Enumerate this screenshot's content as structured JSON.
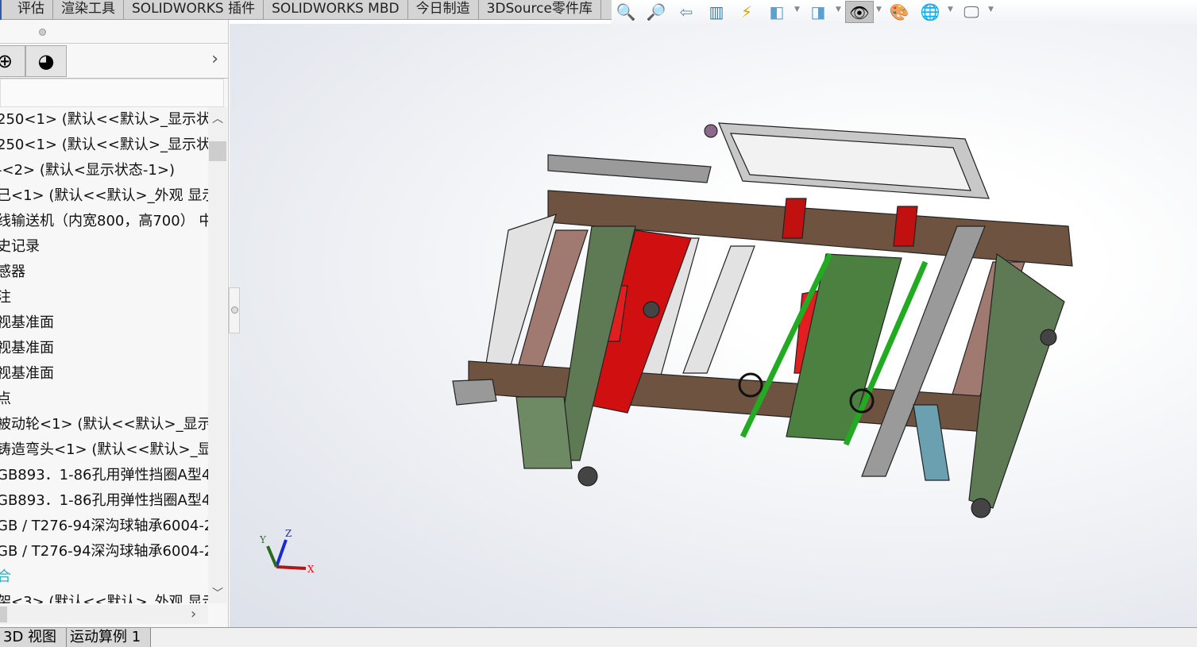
{
  "ribbon_tabs": [
    "评估",
    "渲染工具",
    "SOLIDWORKS 插件",
    "SOLIDWORKS MBD",
    "今日制造",
    "3DSource零件库"
  ],
  "view_toolbar": {
    "icons": [
      "zoom-to-fit-icon",
      "zoom-to-area-icon",
      "previous-view-icon",
      "section-view-icon",
      "dynamic-annotation-view-icon",
      "view-orientation-icon",
      "display-style-icon",
      "hide-show-items-icon",
      "edit-appearance-icon",
      "apply-scene-icon",
      "view-settings-icon"
    ],
    "active": "hide-show-items-icon"
  },
  "panel": {
    "tabs": [
      "configuration-manager-icon",
      "display-manager-icon"
    ],
    "expand_label": "›",
    "tree_items": [
      "250<1> (默认<<默认>_显示状态",
      "250<1> (默认<<默认>_显示状态",
      "‑<2> (默认<显示状态-1>)",
      "己<1> (默认<<默认>_外观 显示状",
      "线输送机（内宽800，高700） 中的",
      "史记录",
      "感器",
      "注",
      "视基准面",
      "视基准面",
      "视基准面",
      "点",
      "被动轮<1> (默认<<默认>_显示状",
      "铸造弯头<1> (默认<<默认>_显示",
      "GB893．1-86孔用弹性挡圈A型42",
      "GB893．1-86孔用弹性挡圈A型42",
      "GB / T276-94深沟球轴承6004-2",
      "GB / T276-94深沟球轴承6004-2",
      "合",
      "架<3> (默认<<默认>_外观 显示状"
    ]
  },
  "bottom_tabs": [
    "3D 视图",
    "运动算例 1"
  ],
  "triad": {
    "x": "X",
    "y": "Y",
    "z": "Z"
  },
  "colors": {
    "frame_green": "#5e7a55",
    "motor_red": "#d01010",
    "rail_brown": "#6e5440",
    "shaft_green": "#22aa22"
  }
}
